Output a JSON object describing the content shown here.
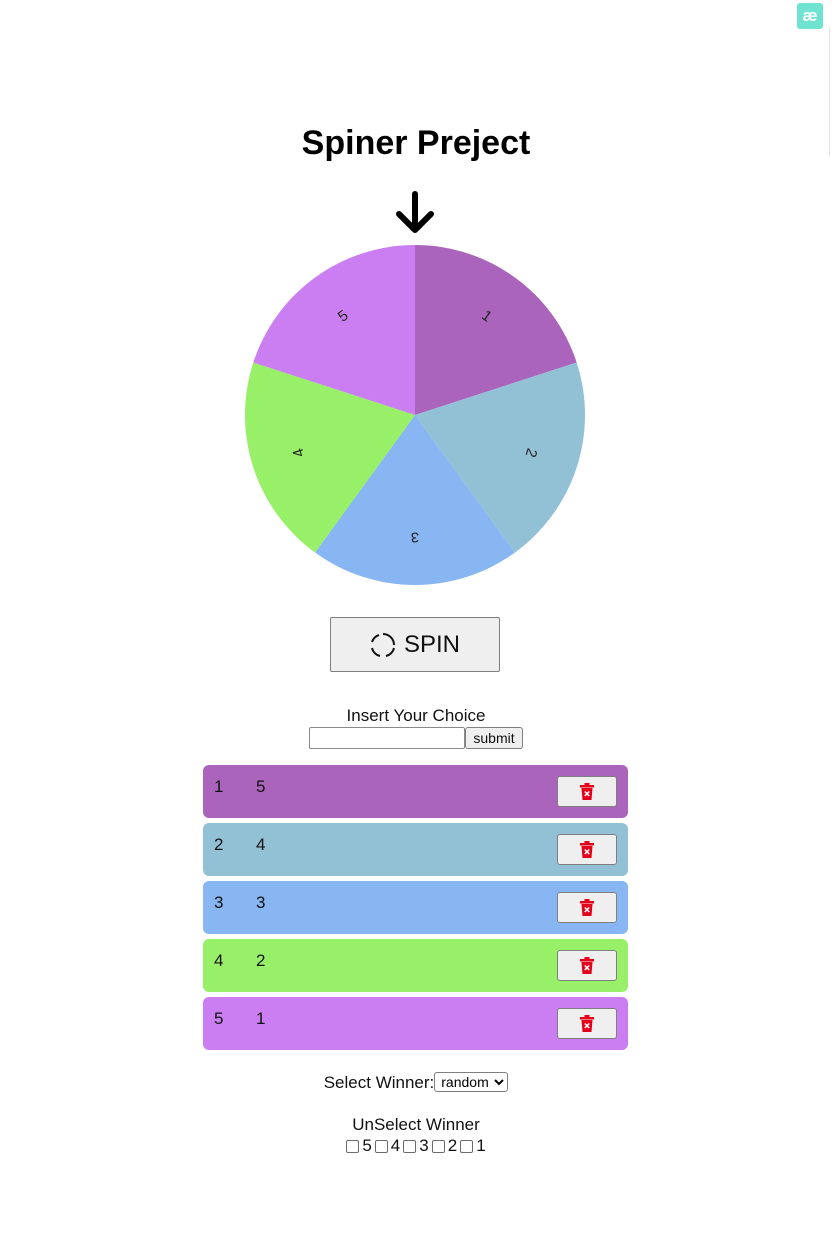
{
  "badge": {
    "text": "æ",
    "color": "#6fe3cf"
  },
  "title": "Spiner Preject",
  "pointer_icon": "arrow-down-icon",
  "wheel": {
    "segments": [
      {
        "label": "1",
        "color": "#aa64bc"
      },
      {
        "label": "2",
        "color": "#92c1d5"
      },
      {
        "label": "3",
        "color": "#87b6f2"
      },
      {
        "label": "4",
        "color": "#97f068"
      },
      {
        "label": "5",
        "color": "#cb7ef2"
      }
    ]
  },
  "spin_button": {
    "label": "SPIN",
    "icon": "refresh-icon"
  },
  "choice_form": {
    "label": "Insert Your Choice",
    "value": "",
    "submit_label": "submit"
  },
  "choices": [
    {
      "index": "1",
      "value": "5",
      "color": "#aa64bc",
      "delete_icon": "trash-icon"
    },
    {
      "index": "2",
      "value": "4",
      "color": "#92c1d5",
      "delete_icon": "trash-icon"
    },
    {
      "index": "3",
      "value": "3",
      "color": "#87b6f2",
      "delete_icon": "trash-icon"
    },
    {
      "index": "4",
      "value": "2",
      "color": "#97f068",
      "delete_icon": "trash-icon"
    },
    {
      "index": "5",
      "value": "1",
      "color": "#cb7ef2",
      "delete_icon": "trash-icon"
    }
  ],
  "winner": {
    "label": "Select Winner:",
    "selected": "random"
  },
  "unselect": {
    "title": "UnSelect Winner",
    "options": [
      {
        "label": "5",
        "checked": false
      },
      {
        "label": "4",
        "checked": false
      },
      {
        "label": "3",
        "checked": false
      },
      {
        "label": "2",
        "checked": false
      },
      {
        "label": "1",
        "checked": false
      }
    ]
  }
}
